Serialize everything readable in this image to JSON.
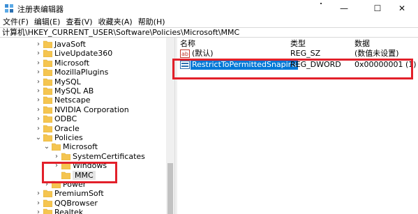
{
  "window": {
    "title": "注册表编辑器",
    "controls": {
      "minimize": "—",
      "maximize": "☐",
      "close": "✕"
    }
  },
  "menu": [
    "文件(F)",
    "编辑(E)",
    "查看(V)",
    "收藏夹(A)",
    "帮助(H)"
  ],
  "address": "计算机\\HKEY_CURRENT_USER\\Software\\Policies\\Microsoft\\MMC",
  "tree": {
    "items": [
      {
        "label": "JavaSoft",
        "level": 2,
        "state": "collapsed"
      },
      {
        "label": "LiveUpdate360",
        "level": 2,
        "state": "collapsed"
      },
      {
        "label": "Microsoft",
        "level": 2,
        "state": "collapsed"
      },
      {
        "label": "MozillaPlugins",
        "level": 2,
        "state": "collapsed"
      },
      {
        "label": "MySQL",
        "level": 2,
        "state": "collapsed"
      },
      {
        "label": "MySQL AB",
        "level": 2,
        "state": "collapsed"
      },
      {
        "label": "Netscape",
        "level": 2,
        "state": "collapsed"
      },
      {
        "label": "NVIDIA Corporation",
        "level": 2,
        "state": "collapsed"
      },
      {
        "label": "ODBC",
        "level": 2,
        "state": "collapsed"
      },
      {
        "label": "Oracle",
        "level": 2,
        "state": "collapsed"
      },
      {
        "label": "Policies",
        "level": 2,
        "state": "expanded"
      },
      {
        "label": "Microsoft",
        "level": 3,
        "state": "expanded"
      },
      {
        "label": "SystemCertificates",
        "level": 4,
        "state": "collapsed"
      },
      {
        "label": "Windows",
        "level": 4,
        "state": "collapsed"
      },
      {
        "label": "MMC",
        "level": 4,
        "state": "leaf",
        "selected": true
      },
      {
        "label": "Power",
        "level": 3,
        "state": "collapsed"
      },
      {
        "label": "PremiumSoft",
        "level": 2,
        "state": "collapsed"
      },
      {
        "label": "QQBrowser",
        "level": 2,
        "state": "collapsed"
      },
      {
        "label": "Realtek",
        "level": 2,
        "state": "collapsed"
      }
    ]
  },
  "list": {
    "columns": {
      "name": "名称",
      "type": "类型",
      "data": "数据"
    },
    "rows": [
      {
        "name": "(默认)",
        "type": "REG_SZ",
        "data": "(数值未设置)",
        "icon": "string-value-icon"
      },
      {
        "name": "RestrictToPermittedSnapins",
        "type": "REG_DWORD",
        "data": "0x00000001 (1)",
        "icon": "dword-value-icon",
        "selected": true
      }
    ]
  },
  "colors": {
    "selection": "#0078d7",
    "annotation": "#e2202a",
    "folder": "#f5c550"
  }
}
